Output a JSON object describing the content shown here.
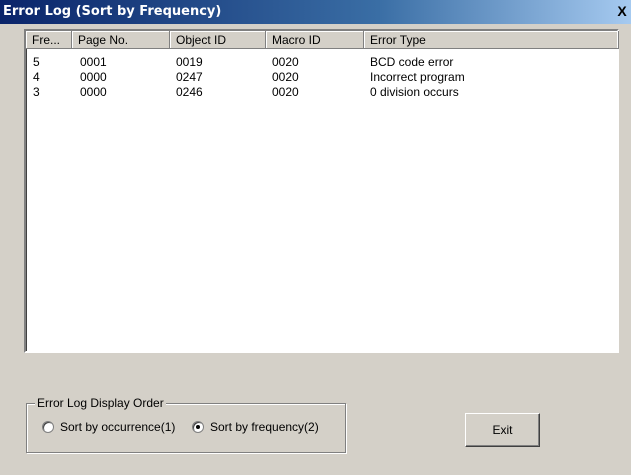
{
  "window": {
    "title": "Error Log (Sort by Frequency)",
    "close_glyph": "X"
  },
  "table": {
    "columns": [
      "Fre...",
      "Page No.",
      "Object ID",
      "Macro ID",
      "Error Type"
    ],
    "rows": [
      [
        "5",
        "0001",
        "0019",
        "0020",
        "BCD code error"
      ],
      [
        "4",
        "0000",
        "0247",
        "0020",
        "Incorrect program"
      ],
      [
        "3",
        "0000",
        "0246",
        "0020",
        "0 division occurs"
      ]
    ]
  },
  "display_order": {
    "label": "Error Log Display Order",
    "option1": "Sort by occurrence(1)",
    "option2": "Sort by frequency(2)",
    "selected": "option2"
  },
  "exit_label": "Exit"
}
